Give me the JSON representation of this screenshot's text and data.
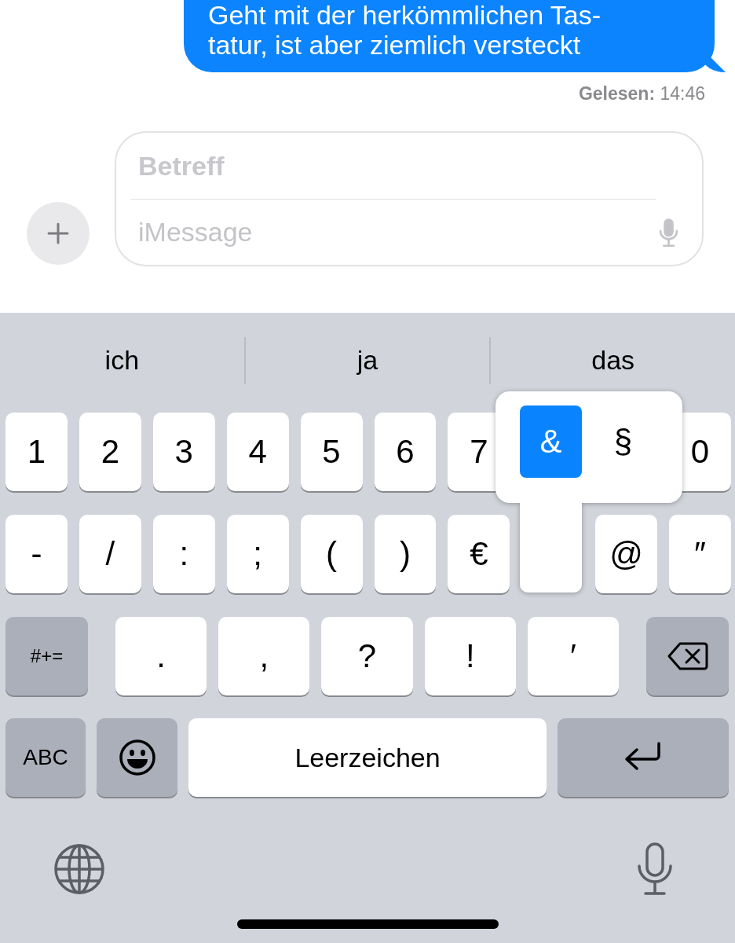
{
  "message": {
    "text": "Geht mit der herkömmlichen Tas-\ntatur, ist aber ziemlich versteckt",
    "receipt": "**Gelesen:** 14:46"
  },
  "composer": {
    "subject_placeholder": "Betreff",
    "message_placeholder": "iMessage"
  },
  "predictions": [
    "ich",
    "ja",
    "das"
  ],
  "number_row": [
    {
      "kind": "key",
      "label": "1"
    },
    {
      "kind": "key",
      "label": "2"
    },
    {
      "kind": "key",
      "label": "3"
    },
    {
      "kind": "key",
      "label": "4"
    },
    {
      "kind": "key",
      "label": "5"
    },
    {
      "kind": "key",
      "label": "6"
    },
    {
      "kind": "key",
      "label": "7"
    },
    {
      "kind": "covered"
    },
    {
      "kind": "covered"
    },
    {
      "kind": "key",
      "label": "0"
    }
  ],
  "symbol_row": [
    {
      "kind": "key",
      "label": "-"
    },
    {
      "kind": "key",
      "label": "/"
    },
    {
      "kind": "key",
      "label": ":"
    },
    {
      "kind": "key",
      "label": ";"
    },
    {
      "kind": "key",
      "label": "("
    },
    {
      "kind": "key",
      "label": ")"
    },
    {
      "kind": "key",
      "label": "€"
    },
    {
      "kind": "pressed"
    },
    {
      "kind": "key",
      "label": "@"
    },
    {
      "kind": "key",
      "label": "″"
    }
  ],
  "popup_options": [
    {
      "label": "&",
      "selected": true
    },
    {
      "label": "§",
      "selected": false
    }
  ],
  "punctuation_row": {
    "mode_key": "#+=",
    "keys": [
      ".",
      ",",
      "?",
      "!",
      "′"
    ]
  },
  "bottom_row": {
    "abc_key": "ABC",
    "space_key": "Leerzeichen"
  }
}
